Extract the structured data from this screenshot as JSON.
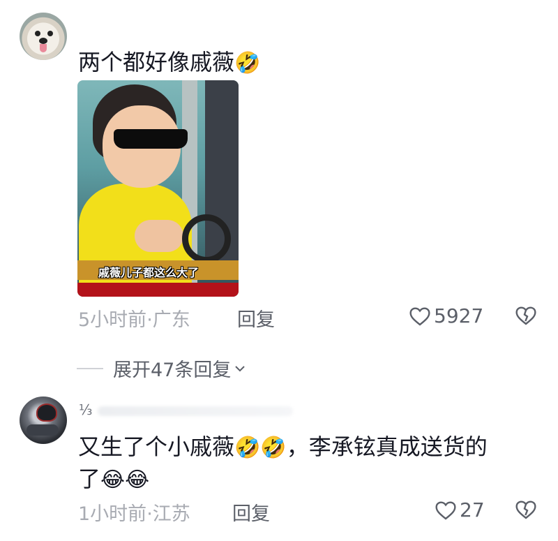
{
  "comments": [
    {
      "text_prefix": "两个都好像戚薇",
      "emojis": [
        "🤣"
      ],
      "image_caption": "戚薇儿子都这么大了",
      "time": "5小时前",
      "location": "广东",
      "reply_label": "回复",
      "like_count": "5927",
      "expand_label": "展开47条回复",
      "icons": [
        "heart-outline-icon",
        "broken-heart-icon",
        "chevron-down-icon"
      ]
    },
    {
      "username": "⅓",
      "line1_prefix": "又生了个小戚薇",
      "line1_emojis": [
        "🤣",
        "🤣"
      ],
      "line1_suffix": "，李承铉真成送货的",
      "line2_prefix": "了",
      "line2_emojis": [
        "😂",
        "😂"
      ],
      "time": "1小时前",
      "location": "江苏",
      "reply_label": "回复",
      "like_count": "27",
      "icons": [
        "heart-outline-icon",
        "broken-heart-icon"
      ]
    }
  ],
  "meta_separator": "·"
}
